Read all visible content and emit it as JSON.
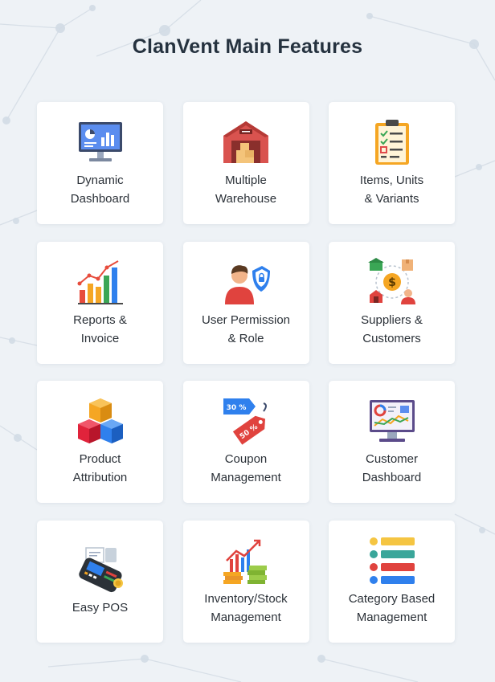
{
  "page": {
    "title": "ClanVent Main Features"
  },
  "theme": {
    "background": "#eef2f6",
    "card_background": "#ffffff",
    "title_color": "#25323f",
    "text_color": "#2b3138"
  },
  "features": [
    {
      "line1": "Dynamic",
      "line2": "Dashboard",
      "icon": "dashboard-monitor-icon"
    },
    {
      "line1": "Multiple",
      "line2": "Warehouse",
      "icon": "warehouse-icon"
    },
    {
      "line1": "Items, Units",
      "line2": "& Variants",
      "icon": "clipboard-checklist-icon"
    },
    {
      "line1": "Reports &",
      "line2": "Invoice",
      "icon": "bar-chart-report-icon"
    },
    {
      "line1": "User Permission",
      "line2": "& Role",
      "icon": "user-shield-icon"
    },
    {
      "line1": "Suppliers &",
      "line2": "Customers",
      "icon": "supplier-customer-network-icon"
    },
    {
      "line1": "Product",
      "line2": "Attribution",
      "icon": "stacked-cubes-icon"
    },
    {
      "line1": "Coupon",
      "line2": "Management",
      "icon": "coupon-tags-icon"
    },
    {
      "line1": "Customer",
      "line2": "Dashboard",
      "icon": "customer-dashboard-monitor-icon"
    },
    {
      "line1": "Easy POS",
      "icon": "pos-terminal-icon"
    },
    {
      "line1": "Inventory/Stock",
      "line2": "Management",
      "icon": "inventory-growth-chart-icon"
    },
    {
      "line1": "Category Based",
      "line2": "Management",
      "icon": "category-list-icon"
    }
  ]
}
